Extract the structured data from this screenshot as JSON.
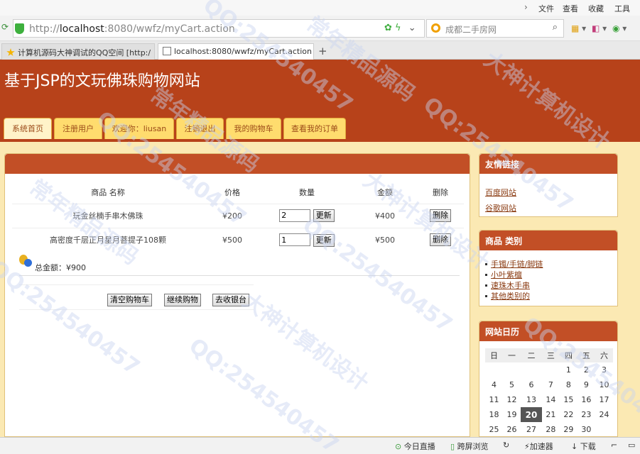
{
  "browser": {
    "menu": [
      "文件",
      "查看",
      "收藏",
      "工具"
    ],
    "url_prefix": "http://",
    "url_host": "localhost",
    "url_rest": ":8080/wwfz/myCart.action",
    "search_placeholder": "成都二手房网",
    "tabs": [
      {
        "label": "计算机源码大神调试的QQ空间 [http:/"
      },
      {
        "label": "localhost:8080/wwfz/myCart.action"
      }
    ],
    "new_tab": "+",
    "close_glyph": "×"
  },
  "site": {
    "title": "基于JSP的文玩佛珠购物网站",
    "nav": [
      "系统首页",
      "注册用户",
      "欢迎你：liusan",
      "注销退出",
      "我的购物车",
      "查看我的订单"
    ]
  },
  "cart": {
    "headers": [
      "商品 名称",
      "价格",
      "数量",
      "金额",
      "删除"
    ],
    "items": [
      {
        "name": "玩金丝楠手串木佛珠",
        "price": "¥200",
        "qty": "2",
        "amount": "¥400"
      },
      {
        "name": "高密度千层正月星月菩提子108颗",
        "price": "¥500",
        "qty": "1",
        "amount": "¥500"
      }
    ],
    "update_label": "更新",
    "delete_label": "删除",
    "total_label": "总金额：¥900",
    "buttons": [
      "清空购物车",
      "继续购物",
      "去收银台"
    ]
  },
  "sidebar": {
    "links_title": "友情链接",
    "links": [
      "百度网站",
      "谷歌网站"
    ],
    "categories_title": "商品 类别",
    "categories": [
      "手镯/手链/脚链",
      "小叶紫檀",
      "速珠木手串",
      "其他类别的"
    ],
    "calendar_title": "网站日历",
    "weekdays": [
      "日",
      "一",
      "二",
      "三",
      "四",
      "五",
      "六"
    ],
    "weeks": [
      [
        "",
        "",
        "",
        "",
        "1",
        "2",
        "3"
      ],
      [
        "4",
        "5",
        "6",
        "7",
        "8",
        "9",
        "10"
      ],
      [
        "11",
        "12",
        "13",
        "14",
        "15",
        "16",
        "17"
      ],
      [
        "18",
        "19",
        "20",
        "21",
        "22",
        "23",
        "24"
      ],
      [
        "25",
        "26",
        "27",
        "28",
        "29",
        "30",
        ""
      ]
    ],
    "today": "20"
  },
  "statusbar": {
    "items": [
      "今日直播",
      "跨屏浏览",
      "加速器",
      "下载"
    ]
  },
  "watermarks": [
    "QQ:254540457",
    "大神计算机设计",
    "常年精品源码"
  ],
  "colors": {
    "banner": "#b7421a",
    "panel_head": "#c24f26",
    "page_bg": "#fbe9b3",
    "nav_tab": "#ffdc6e"
  }
}
